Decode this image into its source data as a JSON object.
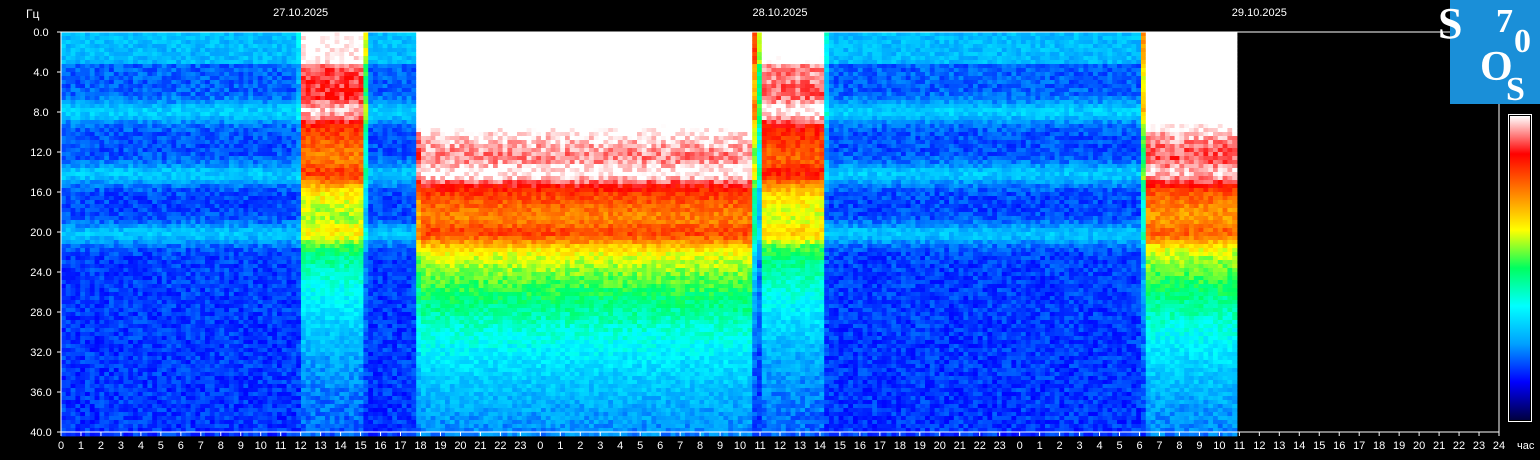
{
  "chart_data": {
    "type": "heatmap",
    "title": "",
    "ylabel": "Гц",
    "xlabel": "час",
    "y_ticks": [
      "0.0",
      "4.0",
      "8.0",
      "12.0",
      "16.0",
      "20.0",
      "24.0",
      "28.0",
      "32.0",
      "36.0",
      "40.0"
    ],
    "ylim": [
      0,
      40
    ],
    "y_direction": "top-to-bottom",
    "x_hour_labels": [
      "0",
      "1",
      "2",
      "3",
      "4",
      "5",
      "6",
      "7",
      "8",
      "9",
      "10",
      "11",
      "12",
      "13",
      "14",
      "15",
      "16",
      "17",
      "18",
      "19",
      "20",
      "21",
      "22",
      "23",
      "0",
      "1",
      "2",
      "3",
      "4",
      "5",
      "6",
      "7",
      "8",
      "9",
      "10",
      "11",
      "12",
      "13",
      "14",
      "15",
      "16",
      "17",
      "18",
      "19",
      "20",
      "21",
      "22",
      "23",
      "0",
      "1",
      "2",
      "3",
      "4",
      "5",
      "6",
      "7",
      "8",
      "9",
      "10",
      "11",
      "12",
      "13",
      "14",
      "15",
      "16",
      "17",
      "18",
      "19",
      "20",
      "21",
      "22",
      "23",
      "24"
    ],
    "dates": [
      {
        "label": "27.10.2025",
        "start_hour": 0
      },
      {
        "label": "28.10.2025",
        "start_hour": 24
      },
      {
        "label": "29.10.2025",
        "start_hour": 48
      }
    ],
    "xlim_hours": [
      0,
      72
    ],
    "data_end_hour": 58.8,
    "colormap": [
      "#000040",
      "#0000ff",
      "#00a0ff",
      "#00ffff",
      "#00ff60",
      "#ffff00",
      "#ff8000",
      "#ff0000",
      "#ffffff"
    ],
    "resonance_bands_hz": [
      7.8,
      14.0,
      20.0
    ],
    "high_activity_periods_hours": [
      {
        "start": 12.0,
        "end": 15.0,
        "level": 0.75
      },
      {
        "start": 17.8,
        "end": 34.5,
        "level": 0.95
      },
      {
        "start": 35.0,
        "end": 38.0,
        "level": 0.78
      },
      {
        "start": 54.2,
        "end": 58.8,
        "level": 0.92
      }
    ]
  },
  "logo": {
    "letters": [
      "S",
      "7",
      "0",
      "O",
      "S"
    ],
    "bg_color": "#1a8fd8"
  }
}
